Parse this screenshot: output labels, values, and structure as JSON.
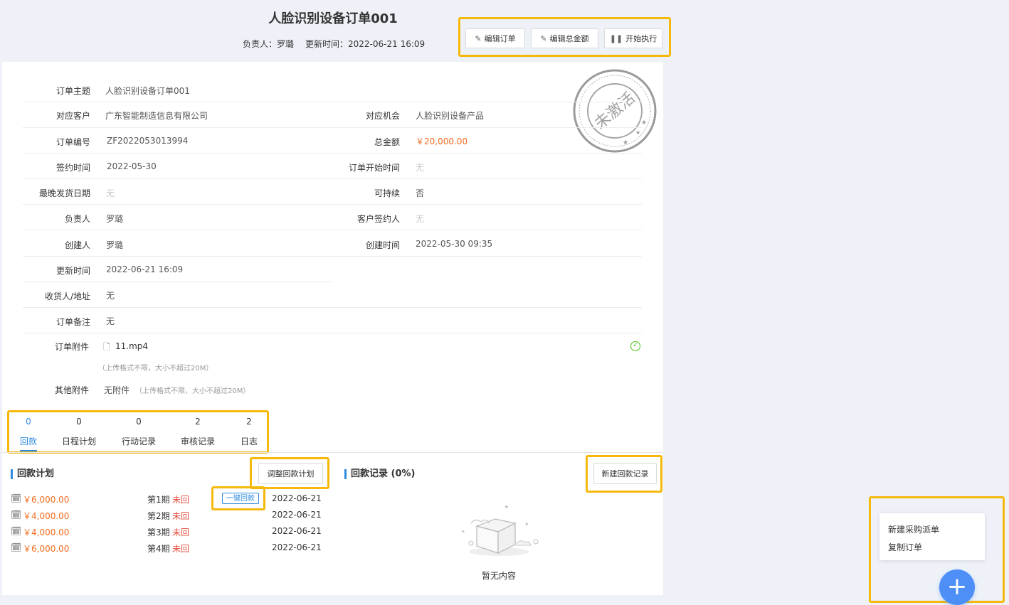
{
  "header": {
    "title": "人脸识别设备订单001",
    "owner_label": "负责人：",
    "owner": "罗璐",
    "updated_label": "更新时间：",
    "updated": "2022-06-21 16:09",
    "buttons": {
      "edit_order": "编辑订单",
      "edit_total": "编辑总金额",
      "start": "开始执行"
    }
  },
  "stamp": {
    "text": "未激活"
  },
  "fields": {
    "subject": {
      "label": "订单主题",
      "value": "人脸识别设备订单001"
    },
    "customer": {
      "label": "对应客户",
      "value": "广东智能制造信息有限公司"
    },
    "opportunity": {
      "label": "对应机会",
      "value": "人脸识别设备产品"
    },
    "order_no": {
      "label": "订单编号",
      "value": "ZF2022053013994"
    },
    "total": {
      "label": "总金额",
      "value": "￥20,000.00"
    },
    "sign_time": {
      "label": "签约时间",
      "value": "2022-05-30"
    },
    "start_time": {
      "label": "订单开始时间",
      "value": "无"
    },
    "latest_ship": {
      "label": "最晚发货日期",
      "value": "无"
    },
    "renewable": {
      "label": "可持续",
      "value": "否"
    },
    "owner": {
      "label": "负责人",
      "value": "罗璐"
    },
    "customer_signer": {
      "label": "客户签约人",
      "value": "无"
    },
    "creator": {
      "label": "创建人",
      "value": "罗璐"
    },
    "created_time": {
      "label": "创建时间",
      "value": "2022-05-30 09:35"
    },
    "update_time": {
      "label": "更新时间",
      "value": "2022-06-21 16:09"
    },
    "receiver": {
      "label": "收货人/地址",
      "value": "无"
    },
    "remark": {
      "label": "订单备注",
      "value": "无"
    },
    "attachment": {
      "label": "订单附件",
      "file": "11.mp4",
      "hint": "（上传格式不限，大小不超过20M）"
    },
    "other_attachment": {
      "label": "其他附件",
      "value": "无附件",
      "hint": "（上传格式不限，大小不超过20M）"
    }
  },
  "tabs": [
    {
      "count": "0",
      "label": "回款",
      "active": true
    },
    {
      "count": "0",
      "label": "日程计划"
    },
    {
      "count": "0",
      "label": "行动记录"
    },
    {
      "count": "2",
      "label": "审核记录"
    },
    {
      "count": "2",
      "label": "日志"
    }
  ],
  "payment_plan": {
    "title": "回款计划",
    "adjust_button": "调整回款计划",
    "one_key_label": "一键回款",
    "rows": [
      {
        "amount": "￥6,000.00",
        "period": "第1期",
        "status": "未回",
        "date": "2022-06-21"
      },
      {
        "amount": "￥4,000.00",
        "period": "第2期",
        "status": "未回",
        "date": "2022-06-21"
      },
      {
        "amount": "￥4,000.00",
        "period": "第3期",
        "status": "未回",
        "date": "2022-06-21"
      },
      {
        "amount": "￥6,000.00",
        "period": "第4期",
        "status": "未回",
        "date": "2022-06-21"
      }
    ]
  },
  "payment_records": {
    "title": "回款记录 (0%)",
    "new_button": "新建回款记录",
    "empty_text": "暂无内容"
  },
  "fab_menu": {
    "items": [
      "新建采购派单",
      "复制订单"
    ],
    "fab_symbol": "+"
  },
  "colors": {
    "accent": "#2f8bdc",
    "amount": "#f26b1d",
    "status_red": "#e84c3d",
    "highlight": "#f5b80b",
    "fab": "#4d8ff7"
  }
}
